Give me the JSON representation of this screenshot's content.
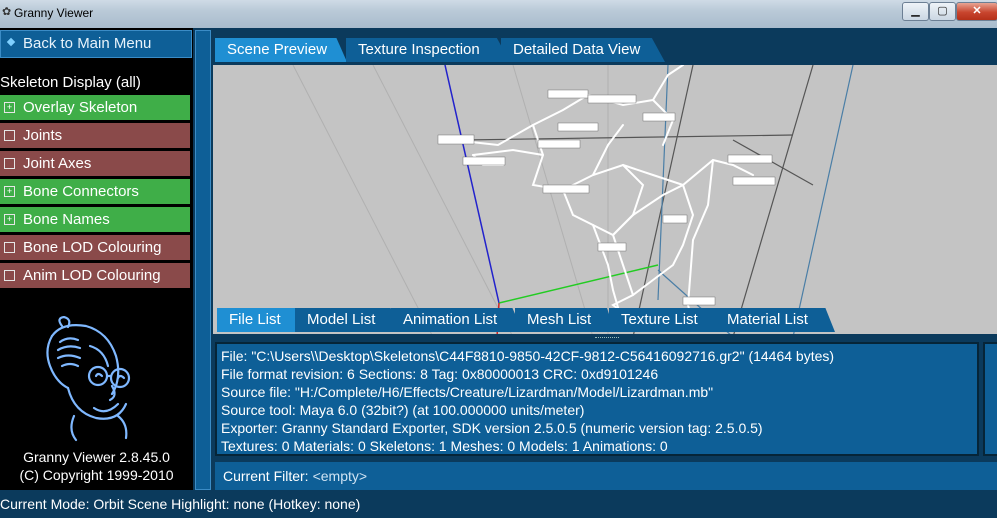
{
  "window": {
    "title": "Granny Viewer",
    "minimize": "▁",
    "maximize": "▢",
    "close": "✕"
  },
  "sidebar": {
    "back_label": "Back to Main Menu",
    "section_title": "Skeleton Display (all)",
    "options": [
      {
        "label": "Overlay Skeleton",
        "checked": true
      },
      {
        "label": "Joints",
        "checked": false
      },
      {
        "label": "Joint Axes",
        "checked": false
      },
      {
        "label": "Bone Connectors",
        "checked": true
      },
      {
        "label": "Bone Names",
        "checked": true
      },
      {
        "label": "Bone LOD Colouring",
        "checked": false
      },
      {
        "label": "Anim LOD Colouring",
        "checked": false
      }
    ],
    "version": "Granny Viewer 2.8.45.0",
    "copyright": "(C) Copyright 1999-2010"
  },
  "top_tabs": [
    {
      "label": "Scene Preview",
      "active": true
    },
    {
      "label": "Texture Inspection",
      "active": false
    },
    {
      "label": "Detailed Data View",
      "active": false
    }
  ],
  "bottom_tabs": [
    {
      "label": "File List",
      "active": true
    },
    {
      "label": "Model List",
      "active": false
    },
    {
      "label": "Animation List",
      "active": false
    },
    {
      "label": "Mesh List",
      "active": false
    },
    {
      "label": "Texture List",
      "active": false
    },
    {
      "label": "Material List",
      "active": false
    }
  ],
  "file_info": [
    "File: \"C:\\Users\\\\Desktop\\Skeletons\\C44F8810-9850-42CF-9812-C56416092716.gr2\" (14464 bytes)",
    "File format revision: 6    Sections: 8    Tag: 0x80000013    CRC: 0xd9101246",
    "Source file: \"H:/Complete/H6/Effects/Creature/Lizardman/Model/Lizardman.mb\"",
    "Source tool: Maya 6.0 (32bit?) (at 100.000000 units/meter)",
    "Exporter: Granny Standard Exporter, SDK version 2.5.0.5 (numeric version tag: 2.5.0.5)",
    "Textures: 0    Materials: 0    Skeletons: 1    Meshes: 0    Models: 1    Animations: 0"
  ],
  "filter": {
    "label": "Current Filter:",
    "value": "<empty>"
  },
  "status": "Current Mode: Orbit Scene   Highlight: none (Hotkey: none)",
  "colors": {
    "panel": "#0e5f97",
    "active_tab": "#1f8fd3",
    "option_on": "#3fae48",
    "option_off": "#8a4a4a",
    "background": "#0b3a5c"
  }
}
